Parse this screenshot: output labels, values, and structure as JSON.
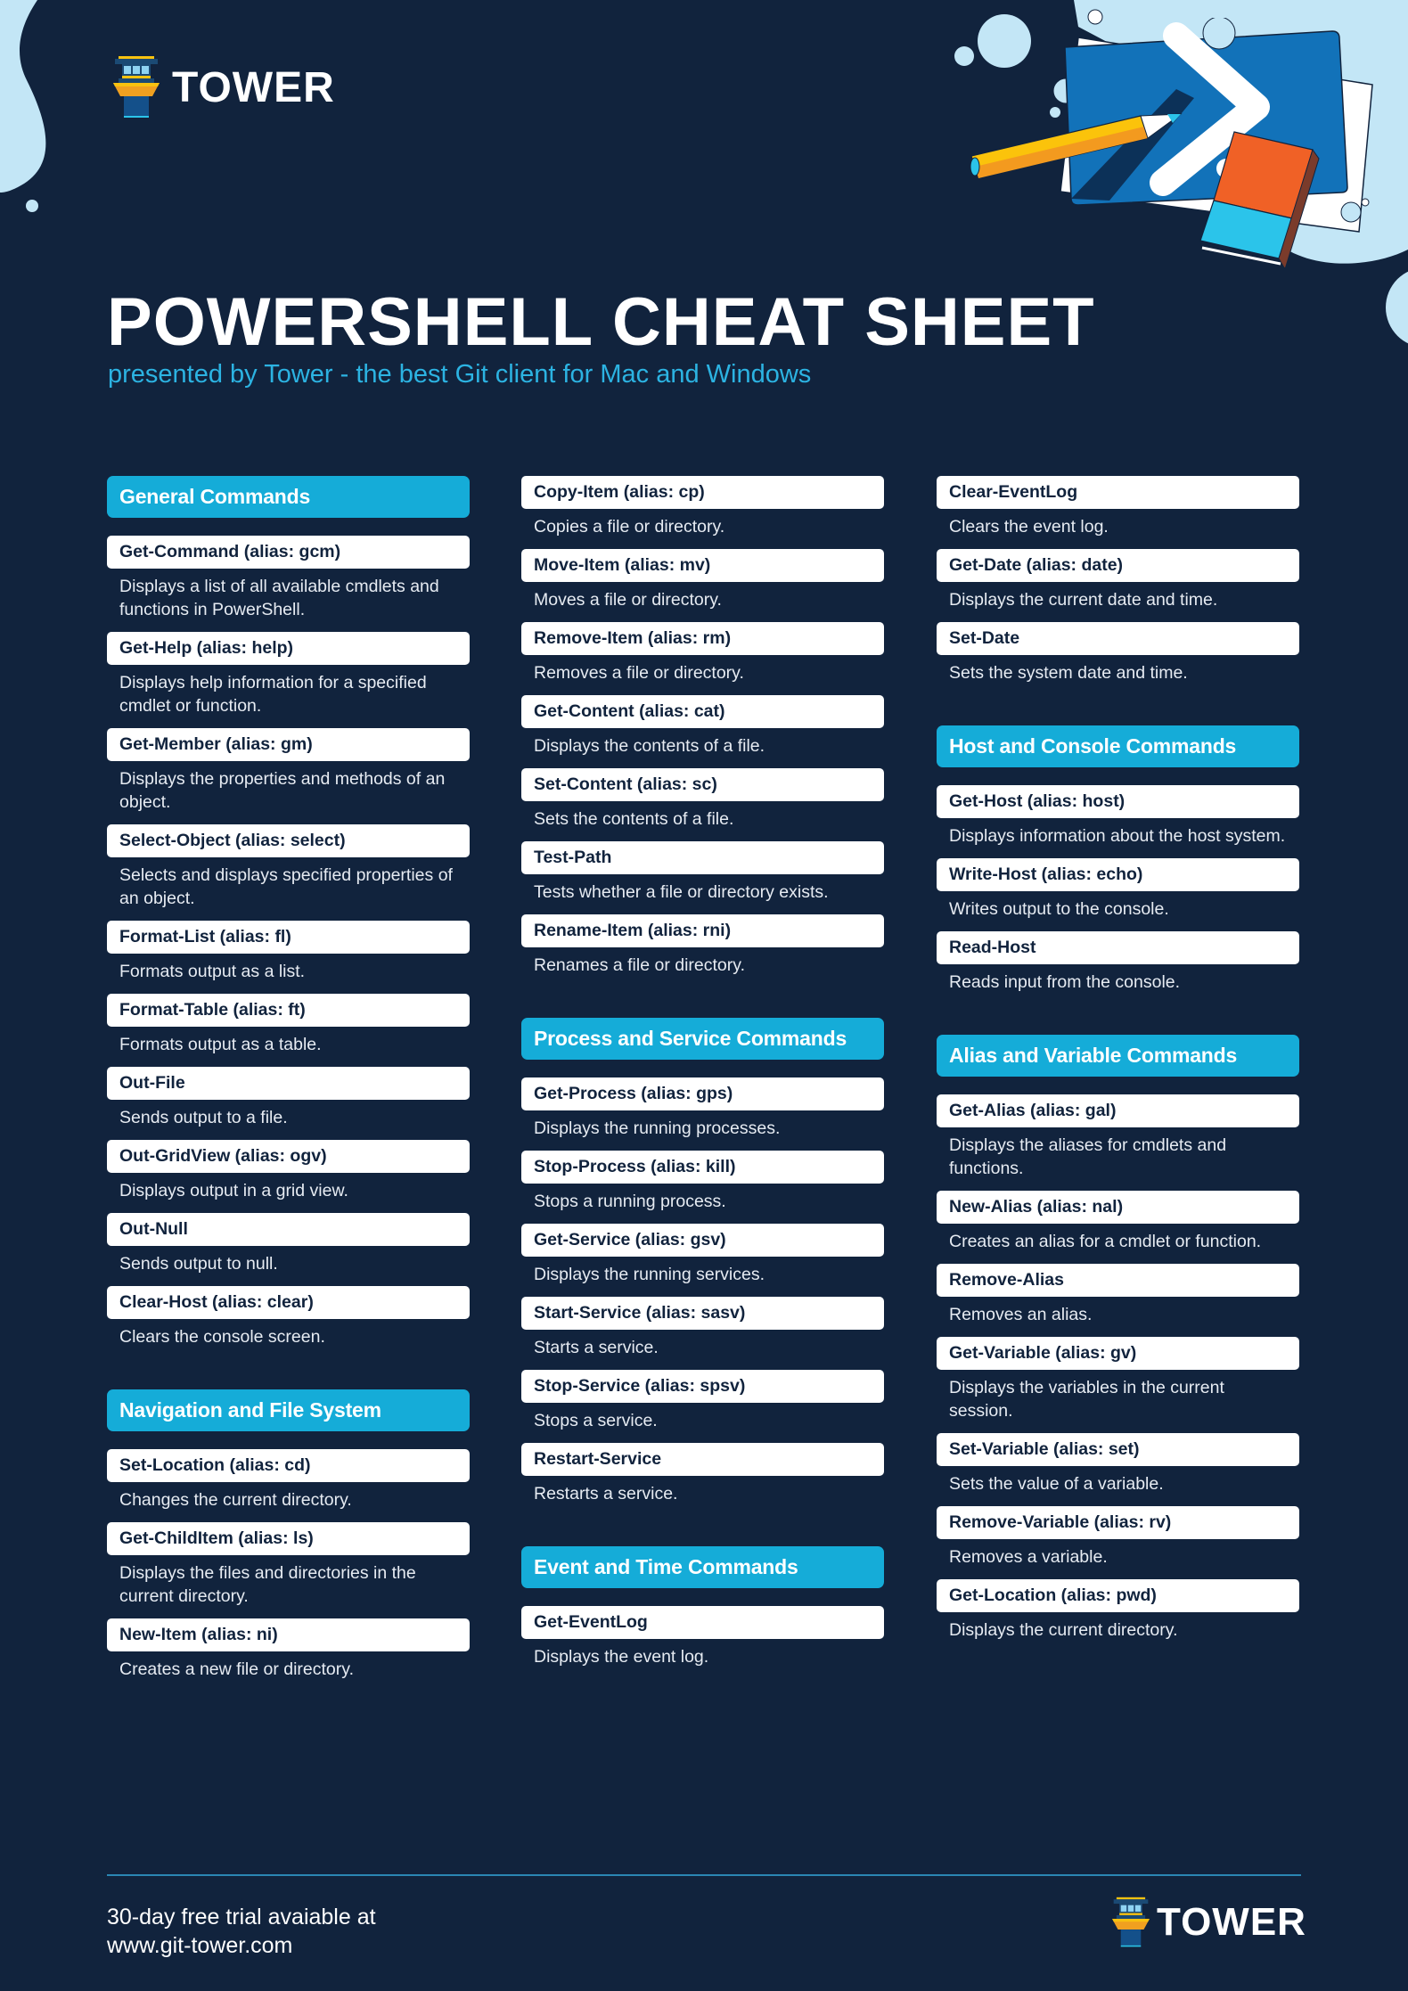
{
  "brand": {
    "name": "TOWER",
    "colors": {
      "background": "#11233d",
      "accent": "#15acd8",
      "subtitle": "#2cb3e2",
      "light_blue_deco": "#c3e6f6"
    }
  },
  "header": {
    "title": "POWERSHELL CHEAT SHEET",
    "subtitle": "presented by Tower - the best Git client for Mac and Windows"
  },
  "illustration": {
    "icons": [
      "powershell-prompt-icon",
      "pencil-icon",
      "eraser-icon"
    ]
  },
  "columns": [
    {
      "sections": [
        {
          "title": "General Commands",
          "commands": [
            {
              "name": "Get-Command (alias: gcm)",
              "desc": "Displays a list of all available cmdlets and functions in PowerShell."
            },
            {
              "name": "Get-Help (alias: help)",
              "desc": "Displays help information for a specified cmdlet or function."
            },
            {
              "name": "Get-Member (alias: gm)",
              "desc": "Displays the properties and methods of an object."
            },
            {
              "name": "Select-Object (alias: select)",
              "desc": "Selects and displays specified properties of an object."
            },
            {
              "name": "Format-List (alias: fl)",
              "desc": "Formats output as a list."
            },
            {
              "name": "Format-Table (alias: ft)",
              "desc": "Formats output as a table."
            },
            {
              "name": "Out-File",
              "desc": "Sends output to a file."
            },
            {
              "name": "Out-GridView (alias: ogv)",
              "desc": "Displays output in a grid view."
            },
            {
              "name": "Out-Null",
              "desc": "Sends output to null."
            },
            {
              "name": "Clear-Host (alias: clear)",
              "desc": "Clears the console screen."
            }
          ]
        },
        {
          "title": "Navigation and File System",
          "commands": [
            {
              "name": "Set-Location (alias: cd)",
              "desc": "Changes the current directory."
            },
            {
              "name": "Get-ChildItem (alias: ls)",
              "desc": "Displays the files and directories in the current directory."
            },
            {
              "name": "New-Item (alias: ni)",
              "desc": "Creates a new file or directory."
            }
          ]
        }
      ]
    },
    {
      "sections": [
        {
          "title": "",
          "commands": [
            {
              "name": "Copy-Item (alias: cp)",
              "desc": "Copies a file or directory."
            },
            {
              "name": "Move-Item (alias: mv)",
              "desc": "Moves a file or directory."
            },
            {
              "name": "Remove-Item (alias: rm)",
              "desc": "Removes a file or directory."
            },
            {
              "name": "Get-Content (alias: cat)",
              "desc": "Displays the contents of a file."
            },
            {
              "name": "Set-Content (alias: sc)",
              "desc": "Sets the contents of a file."
            },
            {
              "name": "Test-Path",
              "desc": "Tests whether a file or directory exists."
            },
            {
              "name": "Rename-Item (alias: rni)",
              "desc": "Renames a file or directory."
            }
          ]
        },
        {
          "title": "Process and Service Commands",
          "commands": [
            {
              "name": "Get-Process (alias: gps)",
              "desc": "Displays the running processes."
            },
            {
              "name": "Stop-Process (alias: kill)",
              "desc": "Stops a running process."
            },
            {
              "name": "Get-Service (alias: gsv)",
              "desc": "Displays the running services."
            },
            {
              "name": "Start-Service (alias: sasv)",
              "desc": "Starts a service."
            },
            {
              "name": "Stop-Service (alias: spsv)",
              "desc": "Stops a service."
            },
            {
              "name": "Restart-Service",
              "desc": "Restarts a service."
            }
          ]
        },
        {
          "title": "Event and Time Commands",
          "commands": [
            {
              "name": "Get-EventLog",
              "desc": "Displays the event log."
            }
          ]
        }
      ]
    },
    {
      "sections": [
        {
          "title": "",
          "commands": [
            {
              "name": "Clear-EventLog",
              "desc": "Clears the event log."
            },
            {
              "name": "Get-Date (alias: date)",
              "desc": "Displays the current date and time."
            },
            {
              "name": "Set-Date",
              "desc": "Sets the system date and time."
            }
          ]
        },
        {
          "title": "Host and Console Commands",
          "commands": [
            {
              "name": "Get-Host (alias: host)",
              "desc": "Displays information about the host system."
            },
            {
              "name": "Write-Host (alias: echo)",
              "desc": "Writes output to the console."
            },
            {
              "name": "Read-Host",
              "desc": "Reads input from the console."
            }
          ]
        },
        {
          "title": "Alias and Variable Commands",
          "commands": [
            {
              "name": "Get-Alias (alias: gal)",
              "desc": "Displays the aliases for cmdlets and functions."
            },
            {
              "name": "New-Alias (alias: nal)",
              "desc": "Creates an alias for a cmdlet or function."
            },
            {
              "name": "Remove-Alias",
              "desc": "Removes an alias."
            },
            {
              "name": "Get-Variable (alias: gv)",
              "desc": "Displays the variables in the current session."
            },
            {
              "name": "Set-Variable (alias: set)",
              "desc": "Sets the value of a variable."
            },
            {
              "name": "Remove-Variable (alias: rv)",
              "desc": "Removes a variable."
            },
            {
              "name": "Get-Location (alias: pwd)",
              "desc": "Displays the current directory."
            }
          ]
        }
      ]
    }
  ],
  "footer": {
    "trial_line1": "30-day free trial avaiable at",
    "trial_line2": "www.git-tower.com"
  }
}
